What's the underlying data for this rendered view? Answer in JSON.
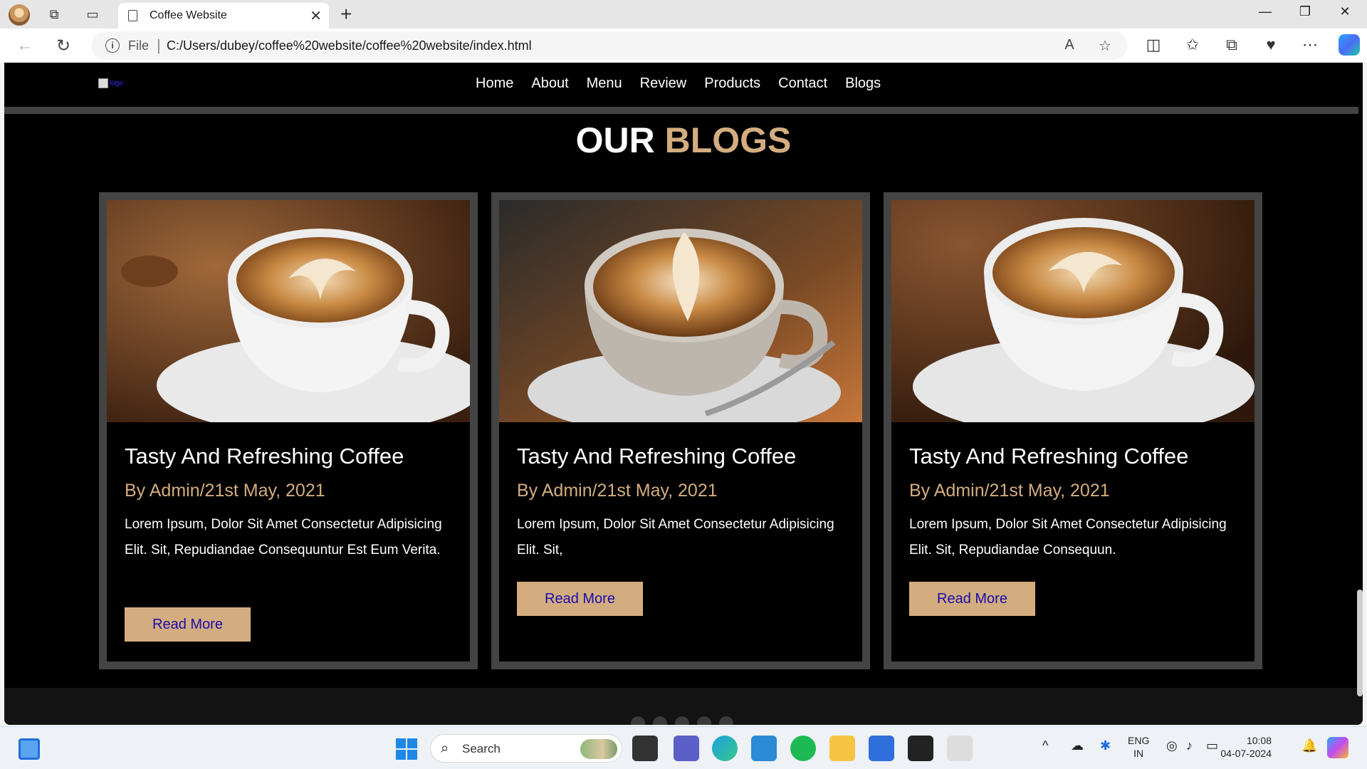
{
  "browser": {
    "tab_title": "Coffee Website",
    "url_scheme_label": "File",
    "url": "C:/Users/dubey/coffee%20website/coffee%20website/index.html"
  },
  "site": {
    "logo_alt": "logo",
    "nav": [
      "Home",
      "About",
      "Menu",
      "Review",
      "Products",
      "Contact",
      "Blogs"
    ],
    "heading_white": "OUR",
    "heading_accent": "Blogs",
    "accent_color": "#d3ad7f",
    "blogs": [
      {
        "title": "Tasty And Refreshing Coffee",
        "meta": "By Admin/21st May, 2021",
        "text": "Lorem Ipsum, Dolor Sit Amet Consectetur Adipisicing Elit. Sit, Repudiandae Consequuntur Est Eum Verita.",
        "button": "Read More"
      },
      {
        "title": "Tasty And Refreshing Coffee",
        "meta": "By Admin/21st May, 2021",
        "text": "Lorem Ipsum, Dolor Sit Amet Consectetur Adipisicing Elit. Sit,",
        "button": "Read More"
      },
      {
        "title": "Tasty And Refreshing Coffee",
        "meta": "By Admin/21st May, 2021",
        "text": "Lorem Ipsum, Dolor Sit Amet Consectetur Adipisicing Elit. Sit, Repudiandae Consequun.",
        "button": "Read More"
      }
    ]
  },
  "taskbar": {
    "search_label": "Search",
    "lang_line1": "ENG",
    "lang_line2": "IN",
    "time": "10:08",
    "date": "04-07-2024"
  }
}
